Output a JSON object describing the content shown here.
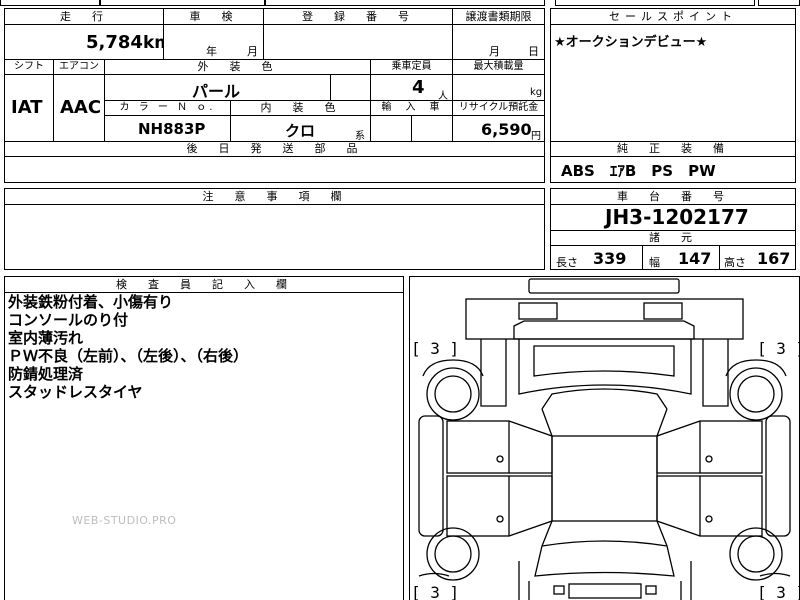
{
  "header": {
    "mileage_label": "走　行",
    "inspection_label": "車　検",
    "registration_label": "登　録　番　号",
    "transfer_label": "譲渡書類期限",
    "sales_point_label": "セールスポイント"
  },
  "mileage": {
    "value": "5,784",
    "unit": "km"
  },
  "inspection": {
    "year_unit": "年",
    "month_unit": "月"
  },
  "transfer": {
    "month_unit": "月",
    "day_unit": "日"
  },
  "sales_point": {
    "text": "★オークションデビュー★"
  },
  "row2_labels": {
    "shift": "シフト",
    "aircon": "エアコン",
    "exterior_color": "外　装　色",
    "capacity": "乗車定員",
    "max_load": "最大積載量"
  },
  "shift_value": "IAT",
  "aircon_value": "AAC",
  "exterior_color_value": "パール",
  "capacity": {
    "value": "4",
    "unit": "人"
  },
  "max_load": {
    "unit": "kg"
  },
  "row3_labels": {
    "color_no": "カ ラ ー Ｎ ｏ.",
    "interior_color": "内　装　色",
    "import": "輸　入　車",
    "recycle": "リサイクル預託金"
  },
  "color_no_value": "NH883P",
  "interior": {
    "value": "クロ",
    "suffix": "系"
  },
  "recycle": {
    "value": "6,590",
    "unit": "円"
  },
  "later_parts_label": "後　日　発　送　部　品",
  "genuine_equipment": {
    "label": "純　正　装　備",
    "value": "ABS　ｴｱB　PS　PW"
  },
  "caution_label": "注　意　事　項　欄",
  "chassis": {
    "label": "車　台　番　号",
    "value": "JH3-1202177"
  },
  "specs": {
    "label": "諸　元",
    "length_label": "長さ",
    "length_value": "339",
    "width_label": "幅",
    "width_value": "147",
    "height_label": "高さ",
    "height_value": "167"
  },
  "inspector": {
    "label": "検　査　員　記　入　欄",
    "notes": [
      "外装鉄粉付着、小傷有り",
      "コンソールのり付",
      "室内薄汚れ",
      "ＰＷ不良（左前）、（左後）、（右後）",
      "防錆処理済",
      "スタッドレスタイヤ"
    ]
  },
  "tread": {
    "front_left": "3",
    "front_right": "3",
    "rear_left": "3",
    "rear_right": "3"
  },
  "watermark": "WEB-STUDIO.PRO"
}
